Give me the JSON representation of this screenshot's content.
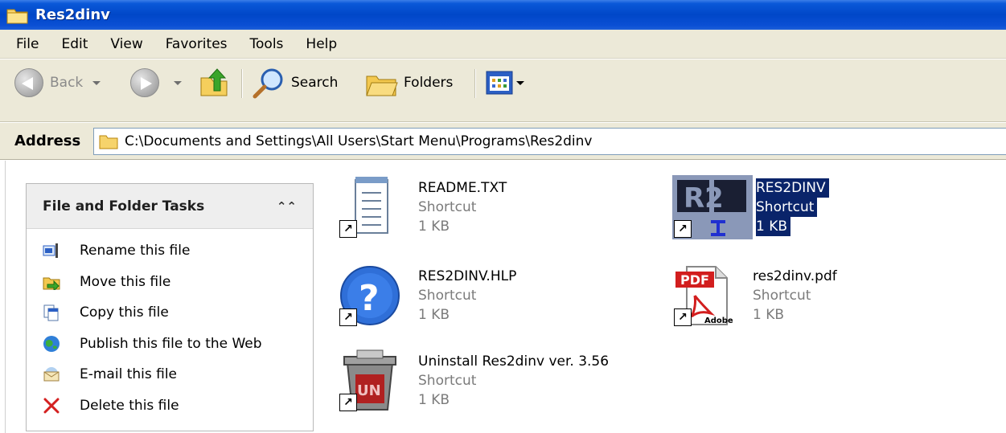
{
  "window": {
    "title": "Res2dinv"
  },
  "menu": [
    "File",
    "Edit",
    "View",
    "Favorites",
    "Tools",
    "Help"
  ],
  "toolbar": {
    "back_label": "Back",
    "search_label": "Search",
    "folders_label": "Folders"
  },
  "address": {
    "label": "Address",
    "path": "C:\\Documents and Settings\\All Users\\Start Menu\\Programs\\Res2dinv"
  },
  "tasks": {
    "title": "File and Folder Tasks",
    "items": [
      {
        "label": "Rename this file",
        "icon": "rename-icon"
      },
      {
        "label": "Move this file",
        "icon": "move-icon"
      },
      {
        "label": "Copy this file",
        "icon": "copy-icon"
      },
      {
        "label": "Publish this file to the Web",
        "icon": "publish-web-icon"
      },
      {
        "label": "E-mail this file",
        "icon": "email-icon"
      },
      {
        "label": "Delete this file",
        "icon": "delete-icon"
      }
    ]
  },
  "files": [
    {
      "name": "README.TXT",
      "type": "Shortcut",
      "size": "1 KB",
      "icon": "notepad-icon",
      "selected": false
    },
    {
      "name": "RES2DINV",
      "type": "Shortcut",
      "size": "1 KB",
      "icon": "res2dinv-app-icon",
      "selected": true
    },
    {
      "name": "RES2DINV.HLP",
      "type": "Shortcut",
      "size": "1 KB",
      "icon": "help-icon",
      "selected": false
    },
    {
      "name": "res2dinv.pdf",
      "type": "Shortcut",
      "size": "1 KB",
      "icon": "pdf-icon",
      "selected": false
    },
    {
      "name": "Uninstall Res2dinv ver. 3.56",
      "type": "Shortcut",
      "size": "1 KB",
      "icon": "uninstall-icon",
      "selected": false
    }
  ],
  "icon_text": {
    "pdf_badge": "PDF",
    "adobe": "Adobe",
    "r2": "R2",
    "uninstall_badge": "UN"
  }
}
